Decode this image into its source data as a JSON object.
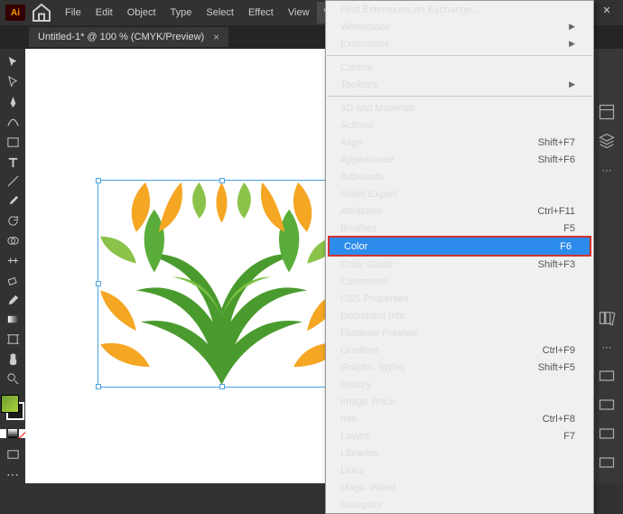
{
  "menubar": [
    "File",
    "Edit",
    "Object",
    "Type",
    "Select",
    "Effect",
    "View",
    "Window"
  ],
  "active_menu_index": 7,
  "doc_tab": {
    "title": "Untitled-1* @ 100 % (CMYK/Preview)",
    "close": "×"
  },
  "dropdown": {
    "groups": [
      [
        {
          "label": "Find Extensions on Exchange...",
          "sub": false
        },
        {
          "label": "Workspace",
          "sub": true
        },
        {
          "label": "Extensions",
          "sub": true
        }
      ],
      [
        {
          "label": "Control",
          "sub": false
        },
        {
          "label": "Toolbars",
          "sub": true
        }
      ],
      [
        {
          "label": "3D and Materials"
        },
        {
          "label": "Actions"
        },
        {
          "label": "Align",
          "shortcut": "Shift+F7"
        },
        {
          "label": "Appearance",
          "shortcut": "Shift+F6"
        },
        {
          "label": "Artboards"
        },
        {
          "label": "Asset Export"
        },
        {
          "label": "Attributes",
          "shortcut": "Ctrl+F11"
        },
        {
          "label": "Brushes",
          "shortcut": "F5"
        },
        {
          "label": "Color",
          "shortcut": "F6",
          "highlight": true
        },
        {
          "label": "Color Guide",
          "shortcut": "Shift+F3"
        },
        {
          "label": "Comments",
          "dim": true
        },
        {
          "label": "CSS Properties"
        },
        {
          "label": "Document Info"
        },
        {
          "label": "Flattener Preview"
        },
        {
          "label": "Gradient",
          "shortcut": "Ctrl+F9"
        },
        {
          "label": "Graphic Styles",
          "shortcut": "Shift+F5"
        },
        {
          "label": "History"
        },
        {
          "label": "Image Trace"
        },
        {
          "label": "Info",
          "shortcut": "Ctrl+F8"
        },
        {
          "label": "Layers",
          "shortcut": "F7"
        },
        {
          "label": "Libraries"
        },
        {
          "label": "Links"
        },
        {
          "label": "Magic Wand"
        },
        {
          "label": "Navigator"
        }
      ]
    ]
  },
  "logo": "Ai"
}
